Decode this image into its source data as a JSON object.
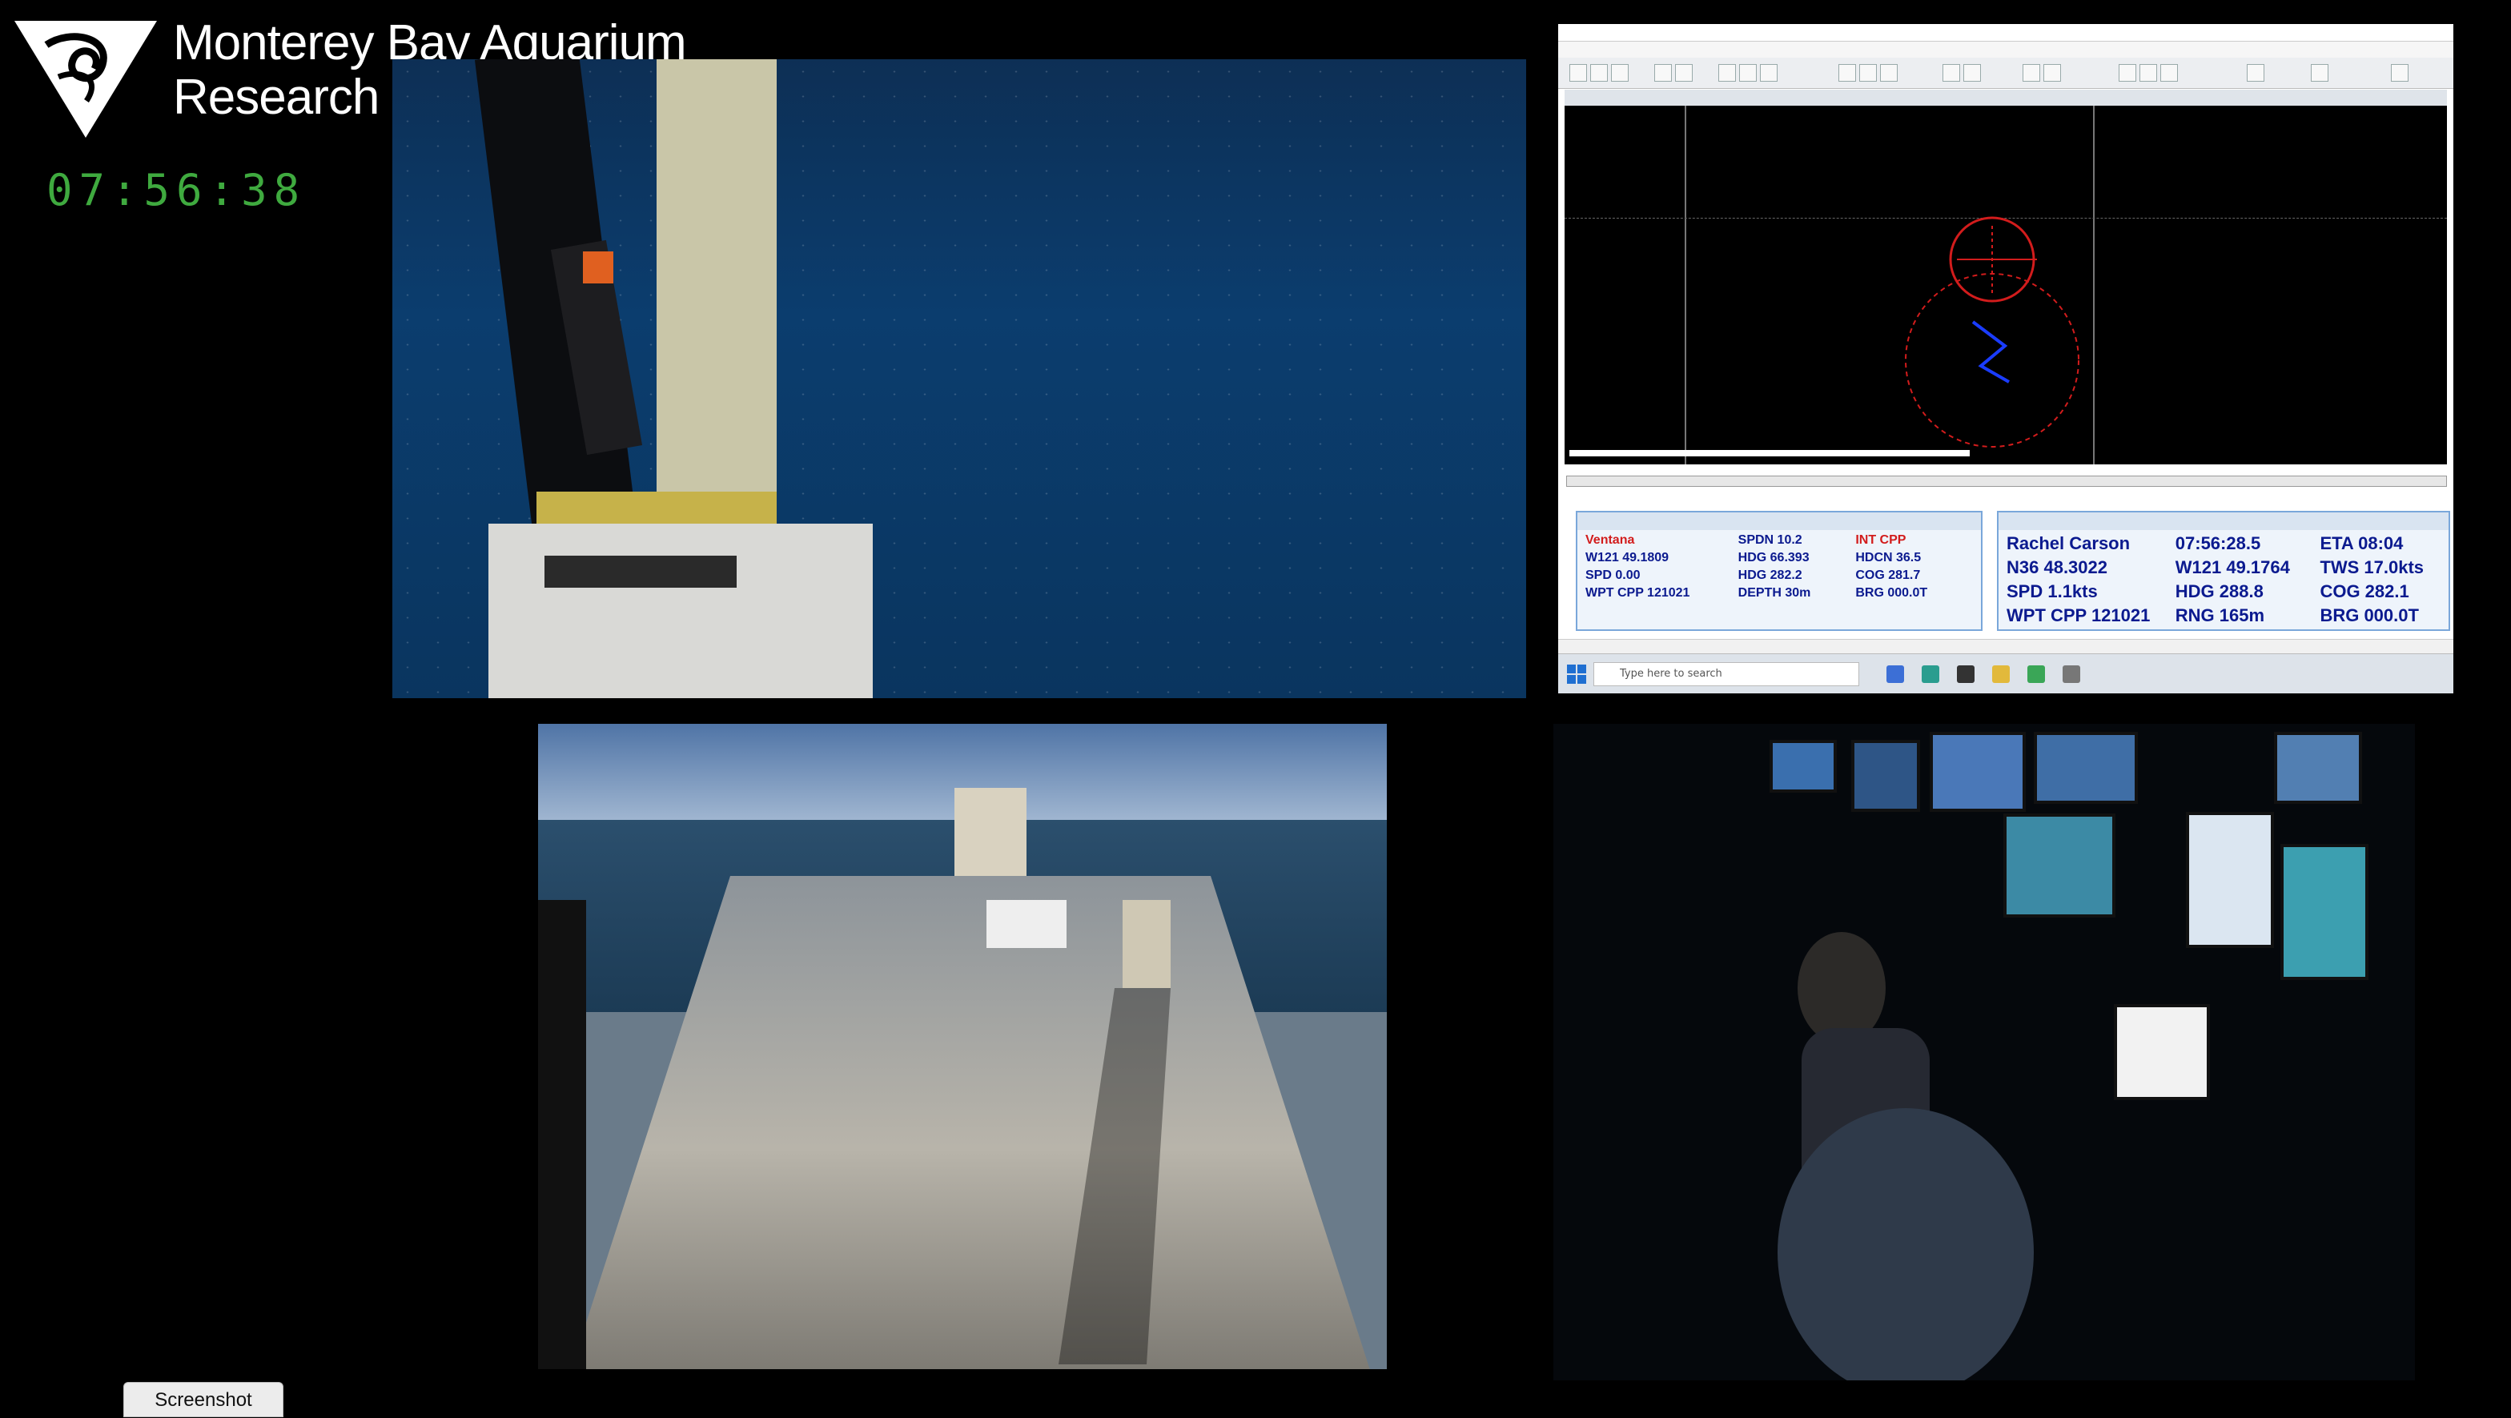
{
  "header": {
    "org_line1": "Monterey Bay Aquarium",
    "org_line2": "Research Institute",
    "clock": "07:56:38"
  },
  "panels": {
    "rov_camera": {
      "icon": "rov-camera-feed"
    },
    "deck_camera": {
      "icon": "ship-deck-camera-feed"
    },
    "control_room_camera": {
      "icon": "control-room-camera-feed"
    }
  },
  "nav_window": {
    "status_left": {
      "rows": [
        [
          "Ventana",
          "SPDN 10.2",
          "INT CPP"
        ],
        [
          "W121 49.1809",
          "HDG 66.393",
          "HDCN 36.5"
        ],
        [
          "SPD 0.00",
          "HDG 282.2",
          "COG 281.7"
        ],
        [
          "WPT CPP 121021",
          "DEPTH 30m",
          "BRG 000.0T"
        ]
      ]
    },
    "status_right": {
      "rows": [
        [
          "Rachel Carson",
          "07:56:28.5",
          "ETA 08:04"
        ],
        [
          "N36 48.3022",
          "W121 49.1764",
          "TWS 17.0kts"
        ],
        [
          "SPD 1.1kts",
          "HDG 288.8",
          "COG 282.1"
        ],
        [
          "WPT CPP 121021",
          "RNG 165m",
          "BRG 000.0T"
        ]
      ]
    },
    "search_placeholder": "Type here to search"
  },
  "buttons": {
    "screenshot": "Screenshot"
  },
  "colors": {
    "clock": "#3faa3f",
    "status_blue": "#0b1a8f",
    "status_red": "#d21c1c",
    "nav_ring": "#d21c1c",
    "nav_vehicle": "#1a3cff"
  }
}
